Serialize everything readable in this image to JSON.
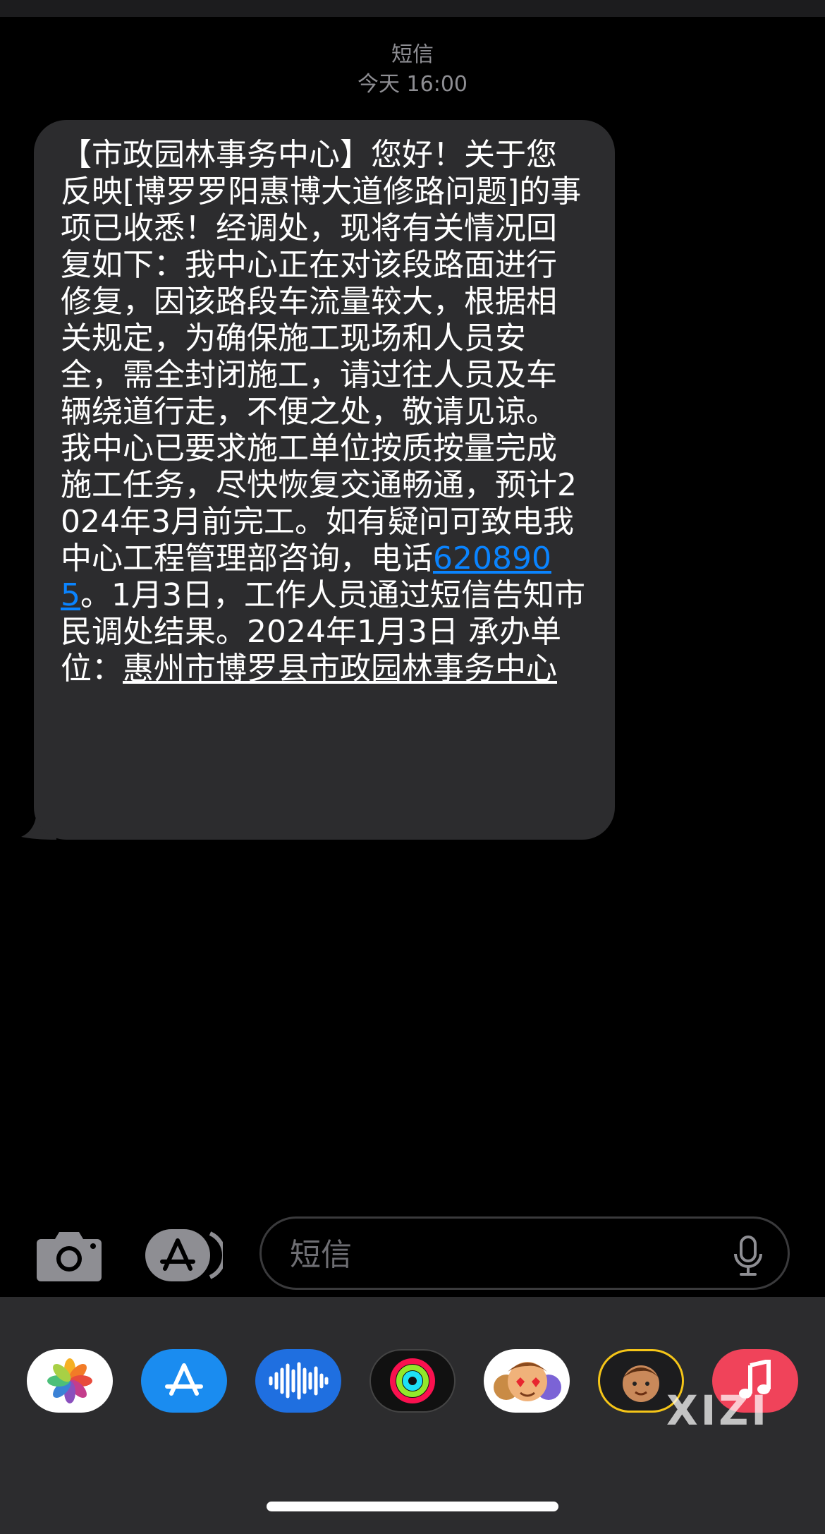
{
  "header": {
    "service": "短信",
    "time": "今天 16:00"
  },
  "message": {
    "text_before": "【市政园林事务中心】您好！关于您反映[博罗罗阳惠博大道修路问题]的事项已收悉！经调处，现将有关情况回复如下：我中心正在对该段路面进行修复，因该路段车流量较大，根据相关规定，为确保施工现场和人员安全，需全封闭施工，请过往人员及车辆绕道行走，不便之处，敬请见谅。我中心已要求施工单位按质按量完成施工任务，尽快恢复交通畅通，预计2024年3月前完工。如有疑问可致电我中心工程管理部咨询，电话",
    "phone": "6208905",
    "text_middle": "。1月3日，工作人员通过短信告知市民调处结果。2024年1月3日 承办单位：",
    "org": "惠州市博罗县市政园林事务中心"
  },
  "input": {
    "placeholder": "短信"
  },
  "drawer_apps": [
    {
      "name": "photos-app-icon"
    },
    {
      "name": "app-store-icon"
    },
    {
      "name": "audio-message-icon"
    },
    {
      "name": "activity-icon"
    },
    {
      "name": "memoji-stickers-icon"
    },
    {
      "name": "memoji-icon"
    },
    {
      "name": "music-icon"
    }
  ],
  "watermark": "XIZI",
  "colors": {
    "bubble": "#2c2c2e",
    "link": "#0a84ff",
    "drawer": "#2c2c2e",
    "background": "#000000"
  }
}
